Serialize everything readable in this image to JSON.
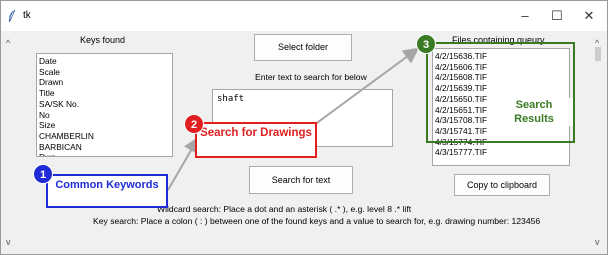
{
  "window": {
    "title": "tk",
    "minimize_glyph": "–",
    "maximize_glyph": "☐",
    "close_glyph": "✕"
  },
  "left_panel": {
    "header": "Keys found",
    "keys": [
      "Date",
      "Scale",
      "Drawn",
      "Title",
      "SA/SK No.",
      "No",
      "Size",
      "CHAMBERLIN",
      "BARBICAN",
      "Dwn"
    ]
  },
  "center": {
    "select_folder_label": "Select folder",
    "search_prompt": "Enter text to search for below",
    "search_text": "shaft",
    "search_button_label": "Search for text"
  },
  "right_panel": {
    "header": "Files containing queury",
    "files": [
      "4/2/15636.TIF",
      "4/2/15606.TIF",
      "4/2/15608.TIF",
      "4/2/15639.TIF",
      "4/2/15650.TIF",
      "4/2/15651.TIF",
      "4/3/15708.TIF",
      "4/3/15741.TIF",
      "4/3/15774.TIF",
      "4/3/15777.TIF"
    ],
    "copy_button_label": "Copy to clipboard"
  },
  "help": {
    "wildcard": "Wildcard search: Place a dot and an asterisk ( .* ), e.g. level 8 .* lift",
    "key_search": "Key search: Place a colon ( : ) between one of the found keys and a value to search for, e.g. drawing number: 123456"
  },
  "annotations": {
    "items": [
      {
        "number": "1",
        "label": "Common Keywords",
        "color": "#1e2bd6"
      },
      {
        "number": "2",
        "label": "Search for Drawings",
        "color": "#e02020"
      },
      {
        "number": "3",
        "label": "Search Results",
        "color": "#3a7a23"
      }
    ],
    "arrow_color": "#a6a6a6"
  },
  "icons": {
    "app": "feather-icon",
    "scroll_up": "chevron-up-icon",
    "scroll_down": "chevron-down-icon"
  }
}
